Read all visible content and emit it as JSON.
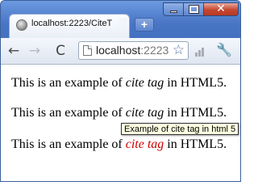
{
  "browser": {
    "tab_title": "localhost:2223/CiteT",
    "new_tab_symbol": "+",
    "controls": {
      "minimize_icon": "minimize-icon",
      "maximize_icon": "maximize-icon",
      "close_icon": "close-icon",
      "close_symbol": "✕"
    },
    "toolbar": {
      "back_symbol": "←",
      "forward_symbol": "→",
      "reload_symbol": "C",
      "address_host": "localhost",
      "address_rest": ":2223",
      "star_symbol": "☆",
      "wrench_symbol": "🔧"
    },
    "colors": {
      "titlebar": "#4f7fc9",
      "close_button": "#c5462f",
      "tooltip_bg": "#ffffe1",
      "cite_red": "#d00000"
    }
  },
  "page": {
    "paragraphs": [
      {
        "before": "This is an example of ",
        "cite": "cite tag",
        "after": " in HTML5."
      },
      {
        "before": "This is an example of ",
        "cite": "cite tag",
        "after": " in HTML5."
      },
      {
        "before": "This is an example of ",
        "cite": "cite tag",
        "after": " in HTML5."
      }
    ],
    "tooltip": "Example of cite tag in html 5"
  }
}
